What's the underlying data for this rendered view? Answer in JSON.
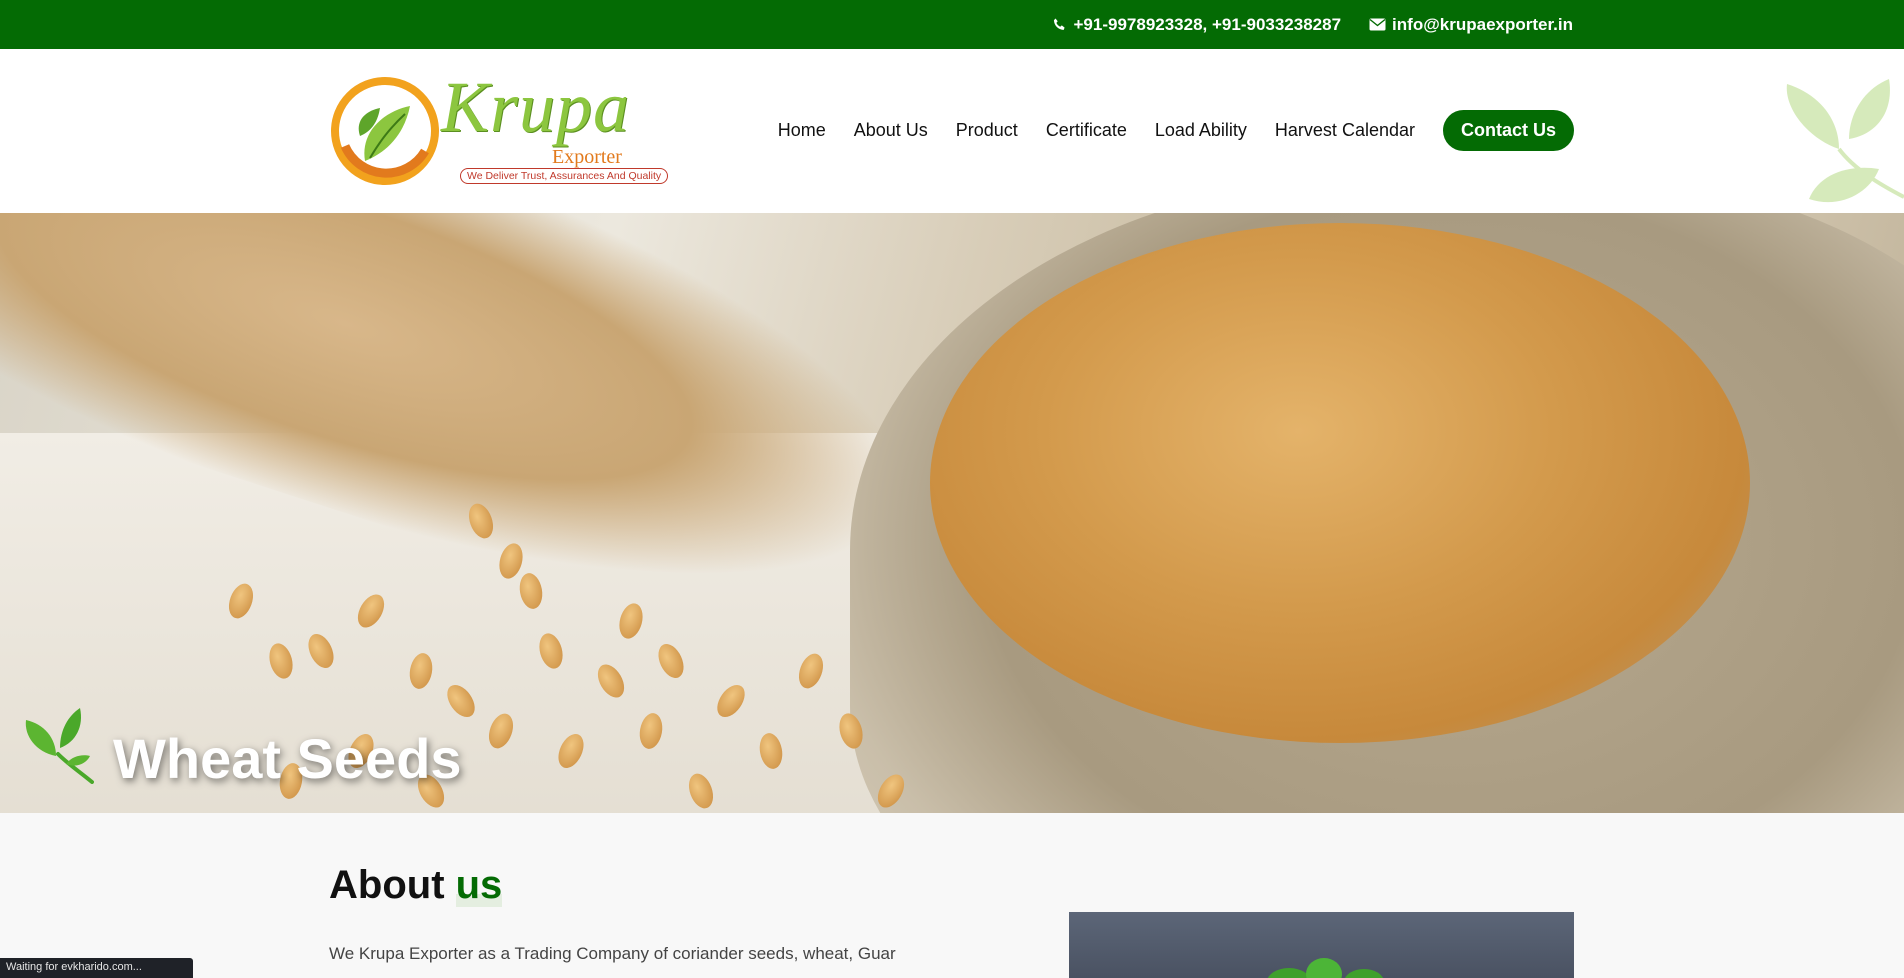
{
  "topbar": {
    "phone_icon": "phone-icon",
    "phone": "+91-9978923328, +91-9033238287",
    "email_icon": "envelope-icon",
    "email": "info@krupaexporter.in"
  },
  "header": {
    "logo": {
      "name": "Krupa",
      "sub": "Exporter",
      "tagline": "We Deliver Trust, Assurances And Quality"
    },
    "nav": [
      {
        "label": "Home"
      },
      {
        "label": "About Us"
      },
      {
        "label": "Product"
      },
      {
        "label": "Certificate"
      },
      {
        "label": "Load Ability"
      },
      {
        "label": "Harvest Calendar"
      }
    ],
    "cta": "Contact Us"
  },
  "hero": {
    "title": "Wheat Seeds",
    "icon": "leaf-icon"
  },
  "about": {
    "title_main": "About ",
    "title_accent": "us",
    "text": "We Krupa Exporter as a Trading Company of coriander seeds, wheat, Guar"
  },
  "status": "Waiting for evkharido.com...",
  "colors": {
    "brand_green": "#046b04",
    "logo_green": "#8cc63f",
    "logo_orange": "#e27a1d"
  }
}
